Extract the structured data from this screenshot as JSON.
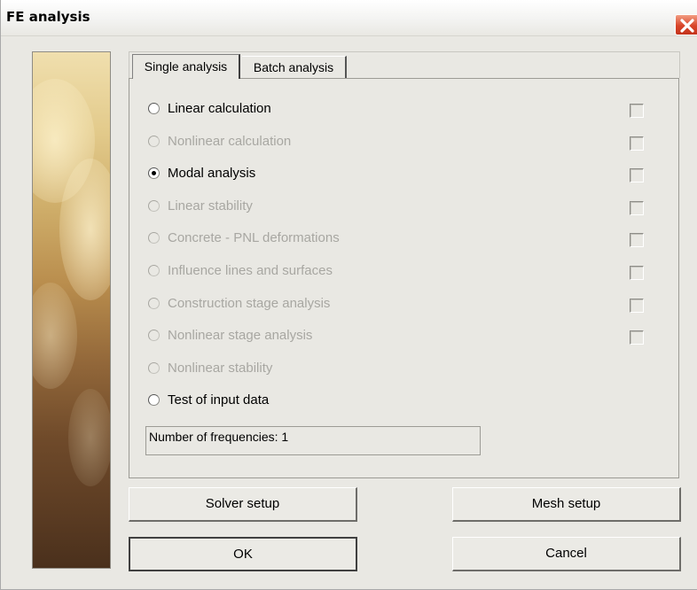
{
  "window": {
    "title": "FE analysis"
  },
  "tabs": [
    {
      "label": "Single analysis",
      "active": true
    },
    {
      "label": "Batch analysis",
      "active": false
    }
  ],
  "options": [
    {
      "label": "Linear calculation",
      "selected": false,
      "enabled": true,
      "has_checkbox": true
    },
    {
      "label": "Nonlinear calculation",
      "selected": false,
      "enabled": false,
      "has_checkbox": true
    },
    {
      "label": "Modal analysis",
      "selected": true,
      "enabled": true,
      "has_checkbox": true
    },
    {
      "label": "Linear stability",
      "selected": false,
      "enabled": false,
      "has_checkbox": true
    },
    {
      "label": "Concrete - PNL deformations",
      "selected": false,
      "enabled": false,
      "has_checkbox": true
    },
    {
      "label": "Influence lines and surfaces",
      "selected": false,
      "enabled": false,
      "has_checkbox": true
    },
    {
      "label": "Construction stage analysis",
      "selected": false,
      "enabled": false,
      "has_checkbox": true
    },
    {
      "label": "Nonlinear stage analysis",
      "selected": false,
      "enabled": false,
      "has_checkbox": true
    },
    {
      "label": "Nonlinear stability",
      "selected": false,
      "enabled": false,
      "has_checkbox": false
    },
    {
      "label": "Test of input data",
      "selected": false,
      "enabled": true,
      "has_checkbox": false
    }
  ],
  "info": {
    "text": "Number of frequencies: 1"
  },
  "buttons": {
    "solver_setup": "Solver setup",
    "mesh_setup": "Mesh setup",
    "ok": "OK",
    "cancel": "Cancel"
  },
  "colors": {
    "dialog_bg": "#e9e8e3",
    "disabled_text": "#a8a7a2",
    "close_button": "#d9452a"
  }
}
